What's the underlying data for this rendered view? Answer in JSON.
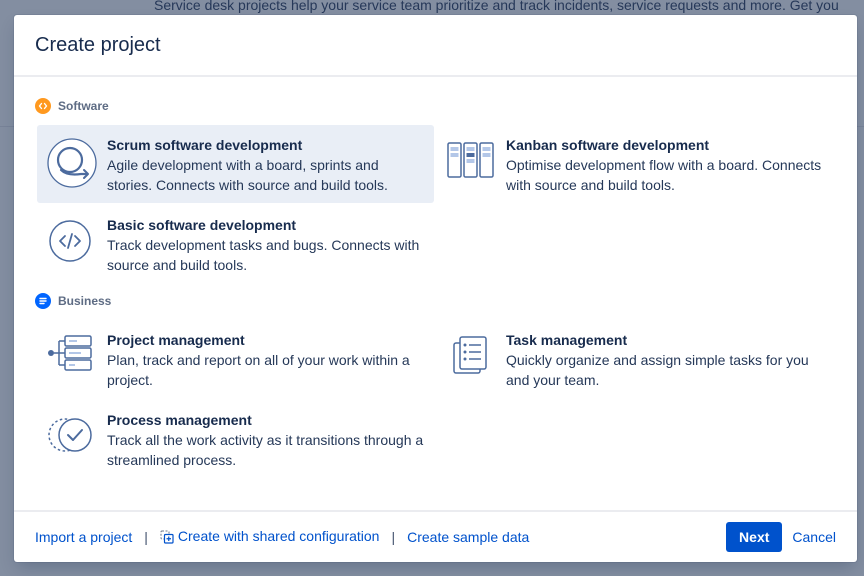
{
  "background": {
    "text": "Service desk projects help your service team prioritize and track incidents, service requests and more. Get you"
  },
  "dialog": {
    "title": "Create project"
  },
  "sections": {
    "software": {
      "label": "Software",
      "icon": "code-brackets-icon",
      "color": "#ff991f"
    },
    "business": {
      "label": "Business",
      "icon": "list-lines-icon",
      "color": "#0065ff"
    }
  },
  "templates": {
    "scrum": {
      "title": "Scrum software development",
      "description": "Agile development with a board, sprints and stories. Connects with source and build tools.",
      "icon": "scrum-cycle-icon",
      "selected": true
    },
    "kanban": {
      "title": "Kanban software development",
      "description": "Optimise development flow with a board. Connects with source and build tools.",
      "icon": "kanban-board-icon"
    },
    "basic": {
      "title": "Basic software development",
      "description": "Track development tasks and bugs. Connects with source and build tools.",
      "icon": "code-circle-icon"
    },
    "project_mgmt": {
      "title": "Project management",
      "description": "Plan, track and report on all of your work within a project.",
      "icon": "project-tree-icon"
    },
    "task_mgmt": {
      "title": "Task management",
      "description": "Quickly organize and assign simple tasks for you and your team.",
      "icon": "task-list-icon"
    },
    "process_mgmt": {
      "title": "Process management",
      "description": "Track all the work activity as it transitions through a streamlined process.",
      "icon": "process-check-icon"
    }
  },
  "footer": {
    "import_link": "Import a project",
    "separator": "|",
    "shared_config_link": "Create with shared configuration",
    "sample_data_link": "Create sample data",
    "next_button": "Next",
    "cancel_button": "Cancel"
  },
  "colors": {
    "primary": "#0052cc",
    "selected_bg": "#e9eef6",
    "text": "#172b4d"
  }
}
